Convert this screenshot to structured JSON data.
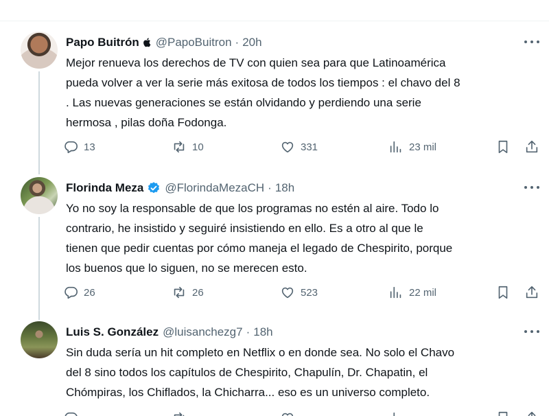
{
  "tweets": [
    {
      "author": "Papo Buitrón",
      "handle": "@PapoBuitron",
      "separator": "·",
      "time": "20h",
      "badge": "apple-icon",
      "text": "Mejor renueva los derechos de TV con quien sea para que Latinoamérica\npueda volver a ver la serie más exitosa de todos los tiempos : el chavo del 8\n. Las nuevas generaciones se están olvidando y perdiendo una serie\nhermosa , pilas doña Fodonga.",
      "replies": "13",
      "retweets": "10",
      "likes": "331",
      "views": "23 mil"
    },
    {
      "author": "Florinda Meza",
      "handle": "@FlorindaMezaCH",
      "separator": "·",
      "time": "18h",
      "badge": "verified-icon",
      "text": "Yo no soy la responsable de que los programas no estén al aire. Todo lo\ncontrario, he insistido y seguiré insistiendo en ello.  Es a otro al que le\ntienen que pedir cuentas por cómo maneja el legado de Chespirito, porque\nlos buenos que lo siguen, no se merecen esto.",
      "replies": "26",
      "retweets": "26",
      "likes": "523",
      "views": "22 mil"
    },
    {
      "author": "Luis S. González",
      "handle": "@luisanchezg7",
      "separator": "·",
      "time": "18h",
      "text": "Sin duda sería un hit completo en Netflix o en donde sea. No solo el Chavo\ndel 8 sino todos los capítulos de Chespirito, Chapulín, Dr. Chapatin, el\nChómpiras, los Chiflados, la Chicharra... eso es un universo completo."
    }
  ],
  "colors": {
    "text": "#0f1419",
    "secondary": "#536471",
    "verified": "#1d9bf0",
    "divider": "#eff3f4",
    "thread_line": "#cfd9de"
  },
  "icons": [
    "reply-icon",
    "retweet-icon",
    "like-icon",
    "views-icon",
    "bookmark-icon",
    "share-icon",
    "more-icon"
  ]
}
